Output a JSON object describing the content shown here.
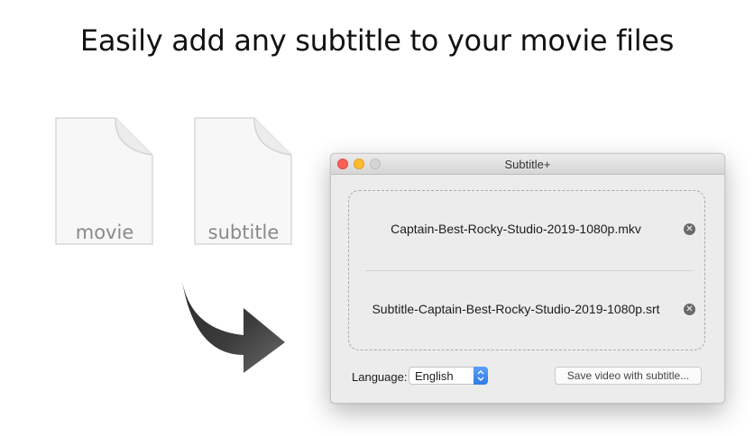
{
  "headline": "Easily add any subtitle to your movie files",
  "icons": {
    "movie_label": "movie",
    "subtitle_label": "subtitle"
  },
  "window": {
    "title": "Subtitle+",
    "files": [
      {
        "name": "Captain-Best-Rocky-Studio-2019-1080p.mkv"
      },
      {
        "name": "Subtitle-Captain-Best-Rocky-Studio-2019-1080p.srt"
      }
    ],
    "language_label": "Language:",
    "language_value": "English",
    "save_button": "Save video with subtitle..."
  },
  "colors": {
    "close": "#fc5f57",
    "minimize": "#fdbc2e",
    "accent": "#2f7ae6"
  }
}
